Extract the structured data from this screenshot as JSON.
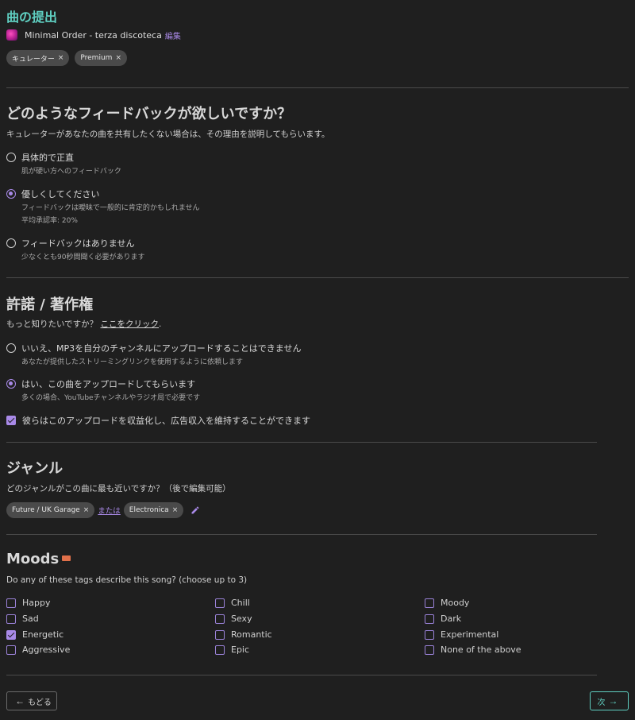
{
  "title": "曲の提出",
  "song": {
    "name": "Minimal Order - terza discoteca",
    "edit": "編集"
  },
  "top_tags": [
    {
      "label": "キュレーター"
    },
    {
      "label": "Premium"
    }
  ],
  "feedback": {
    "heading": "どのようなフィードバックが欲しいですか？",
    "description": "キュレーターがあなたの曲を共有したくない場合は、その理由を説明してもらいます。",
    "options": [
      {
        "label": "具体的で正直",
        "sub1": "肌が硬い方へのフィードバック",
        "sub2": "",
        "selected": false
      },
      {
        "label": "優しくしてください",
        "sub1": "フィードバックは曖昧で一般的に肯定的かもしれません",
        "sub2": "平均承認率: 20%",
        "selected": true
      },
      {
        "label": "フィードバックはありません",
        "sub1": "少なくとも90秒間聞く必要があります",
        "sub2": "",
        "selected": false
      }
    ]
  },
  "permission": {
    "heading": "許諾 / 著作権",
    "description": "もっと知りたいですか？",
    "link": "ここをクリック",
    "period": ".",
    "options": [
      {
        "label": "いいえ、MP3を自分のチャンネルにアップロードすることはできません",
        "sub": "あなたが提供したストリーミングリンクを使用するように依頼します",
        "selected": false
      },
      {
        "label": "はい、この曲をアップロードしてもらいます",
        "sub": "多くの場合、YouTubeチャンネルやラジオ局で必要です",
        "selected": true
      }
    ],
    "monetize": {
      "label": "彼らはこのアップロードを収益化し、広告収入を維持することができます",
      "checked": true
    }
  },
  "genre": {
    "heading": "ジャンル",
    "description": "どのジャンルがこの曲に最も近いですか？（後で編集可能）",
    "tags": [
      "Future / UK Garage",
      "Electronica"
    ],
    "or": "または"
  },
  "moods": {
    "heading": "Moods",
    "description": "Do any of these tags describe this song? (choose up to 3)",
    "items": [
      {
        "label": "Happy",
        "checked": false
      },
      {
        "label": "Sad",
        "checked": false
      },
      {
        "label": "Energetic",
        "checked": true
      },
      {
        "label": "Aggressive",
        "checked": false
      },
      {
        "label": "Chill",
        "checked": false
      },
      {
        "label": "Sexy",
        "checked": false
      },
      {
        "label": "Romantic",
        "checked": false
      },
      {
        "label": "Epic",
        "checked": false
      },
      {
        "label": "Moody",
        "checked": false
      },
      {
        "label": "Dark",
        "checked": false
      },
      {
        "label": "Experimental",
        "checked": false
      },
      {
        "label": "None of the above",
        "checked": false
      }
    ]
  },
  "nav": {
    "back": "もどる",
    "next": "次"
  },
  "colors": {
    "accent": "#5fcfc1",
    "purple": "#a98ae8",
    "background": "#1f1f1f"
  }
}
